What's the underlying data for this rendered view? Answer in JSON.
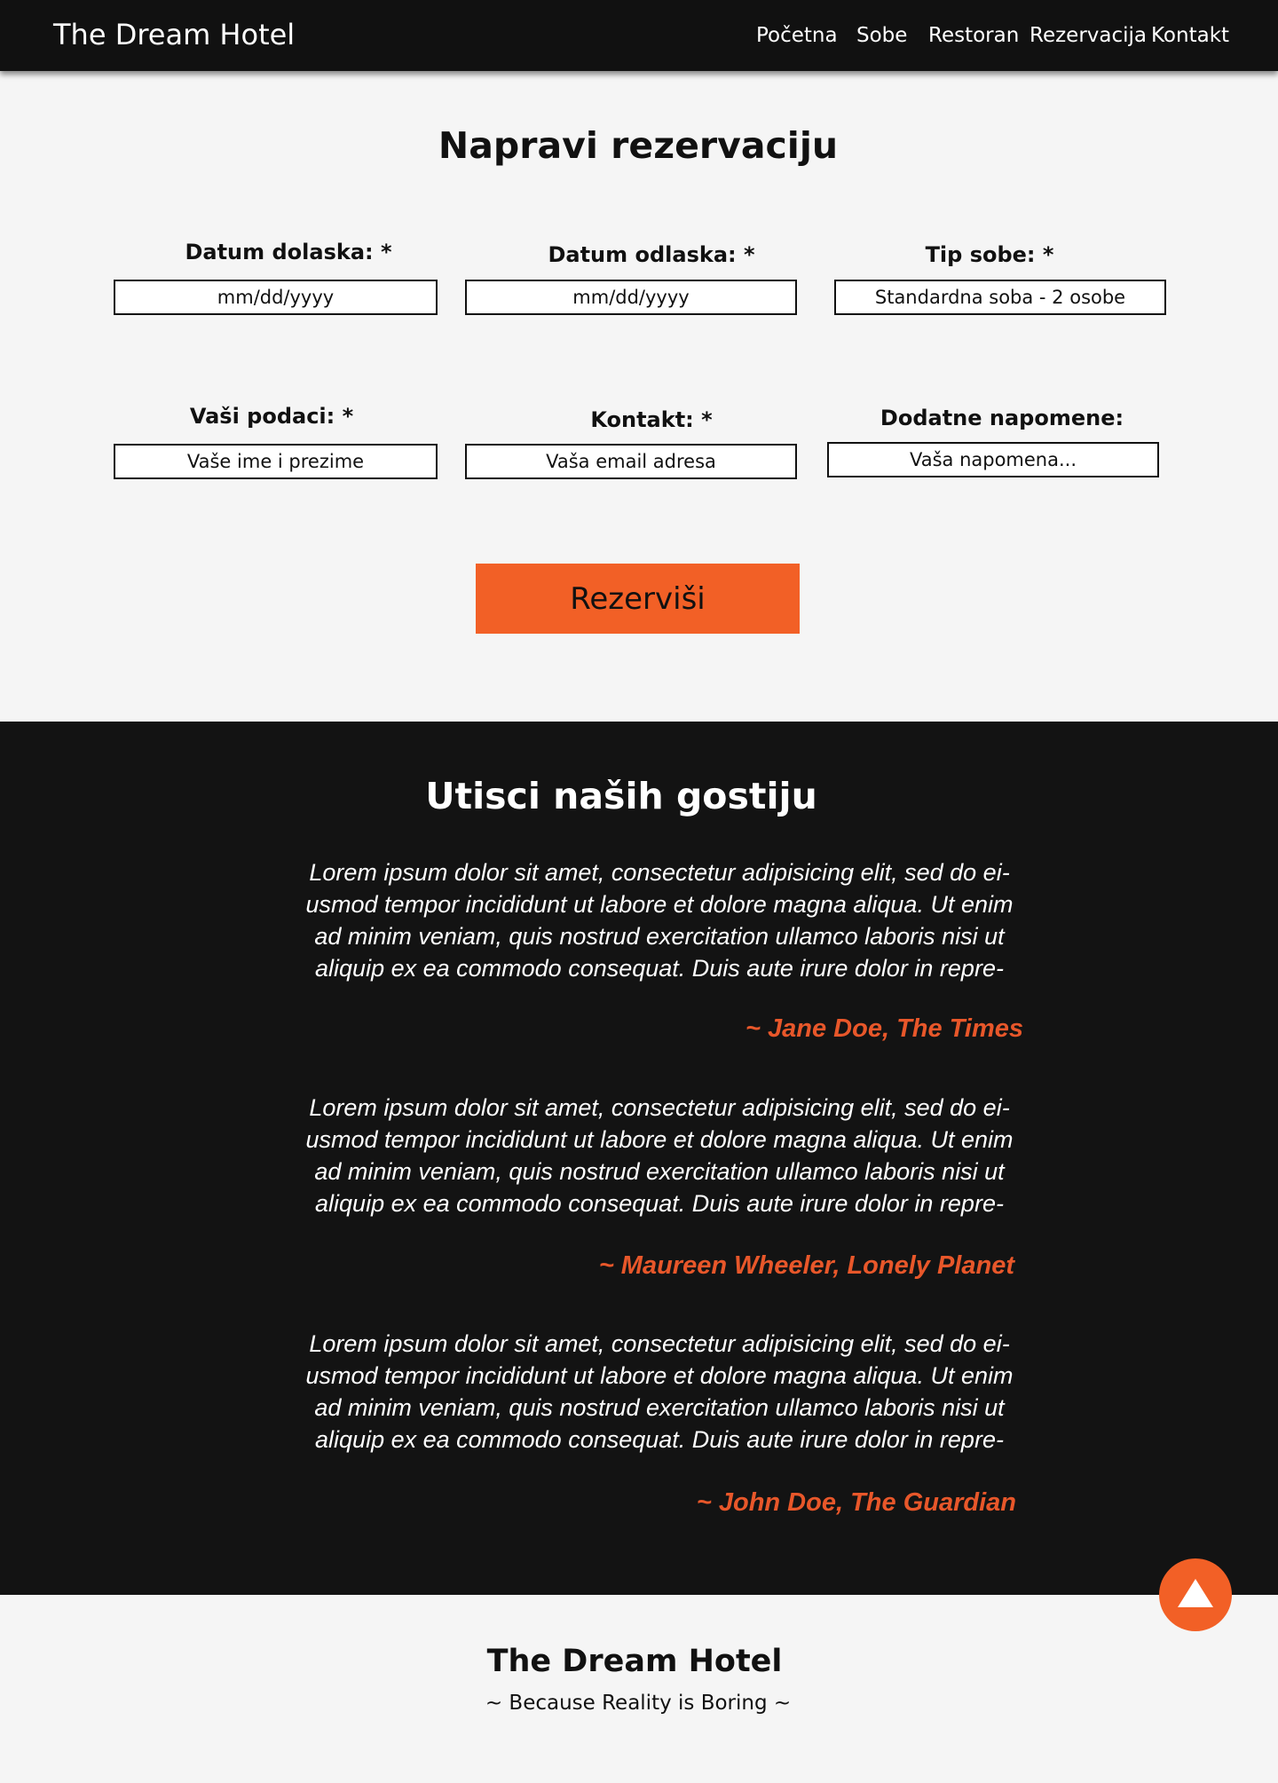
{
  "nav": {
    "brand": "The Dream Hotel",
    "links": [
      "Početna",
      "Sobe",
      "Restoran",
      "Rezervacija",
      "Kontakt"
    ]
  },
  "reservation": {
    "title": "Napravi rezervaciju",
    "fields": {
      "arrival": {
        "label": "Datum dolaska: *",
        "placeholder": "mm/dd/yyyy"
      },
      "departure": {
        "label": "Datum odlaska: *",
        "placeholder": "mm/dd/yyyy"
      },
      "room_type": {
        "label": "Tip sobe: *",
        "value": "Standardna soba - 2 osobe"
      },
      "name": {
        "label": "Vaši podaci: *",
        "placeholder": "Vaše ime i prezime"
      },
      "contact": {
        "label": "Kontakt: *",
        "placeholder": "Vaša email adresa"
      },
      "notes": {
        "label": "Dodatne napomene:",
        "placeholder": "Vaša napomena..."
      }
    },
    "submit_label": "Rezerviši"
  },
  "testimonials": {
    "title": "Utisci naših gostiju",
    "items": [
      {
        "lines": [
          "Lorem ipsum dolor sit amet, consectetur adipisicing elit, sed do ei-",
          "usmod tempor incididunt ut labore et dolore magna aliqua. Ut enim",
          "ad minim veniam, quis nostrud exercitation ullamco laboris nisi ut",
          "aliquip ex ea commodo consequat. Duis aute irure dolor in repre-"
        ],
        "author": "~ Jane Doe, The Times"
      },
      {
        "lines": [
          "Lorem ipsum dolor sit amet, consectetur adipisicing elit, sed do ei-",
          "usmod tempor incididunt ut labore et dolore magna aliqua. Ut enim",
          "ad minim veniam, quis nostrud exercitation ullamco laboris nisi ut",
          "aliquip ex ea commodo consequat. Duis aute irure dolor in repre-"
        ],
        "author": "~ Maureen Wheeler, Lonely Planet"
      },
      {
        "lines": [
          "Lorem ipsum dolor sit amet, consectetur adipisicing elit, sed do ei-",
          "usmod tempor incididunt ut labore et dolore magna aliqua. Ut enim",
          "ad minim veniam, quis nostrud exercitation ullamco laboris nisi ut",
          "aliquip ex ea commodo consequat. Duis aute irure dolor in repre-"
        ],
        "author": "~ John Doe, The Guardian"
      }
    ]
  },
  "scroll_top": {
    "icon": "arrow-up-triangle-icon"
  },
  "footer": {
    "title": "The Dream Hotel",
    "subtitle": "~ Because Reality is Boring ~"
  },
  "colors": {
    "nav_bg": "#111111",
    "accent": "#f26026",
    "author": "#e8572a",
    "dark_section": "#131313",
    "page_bg": "#f5f5f5"
  }
}
